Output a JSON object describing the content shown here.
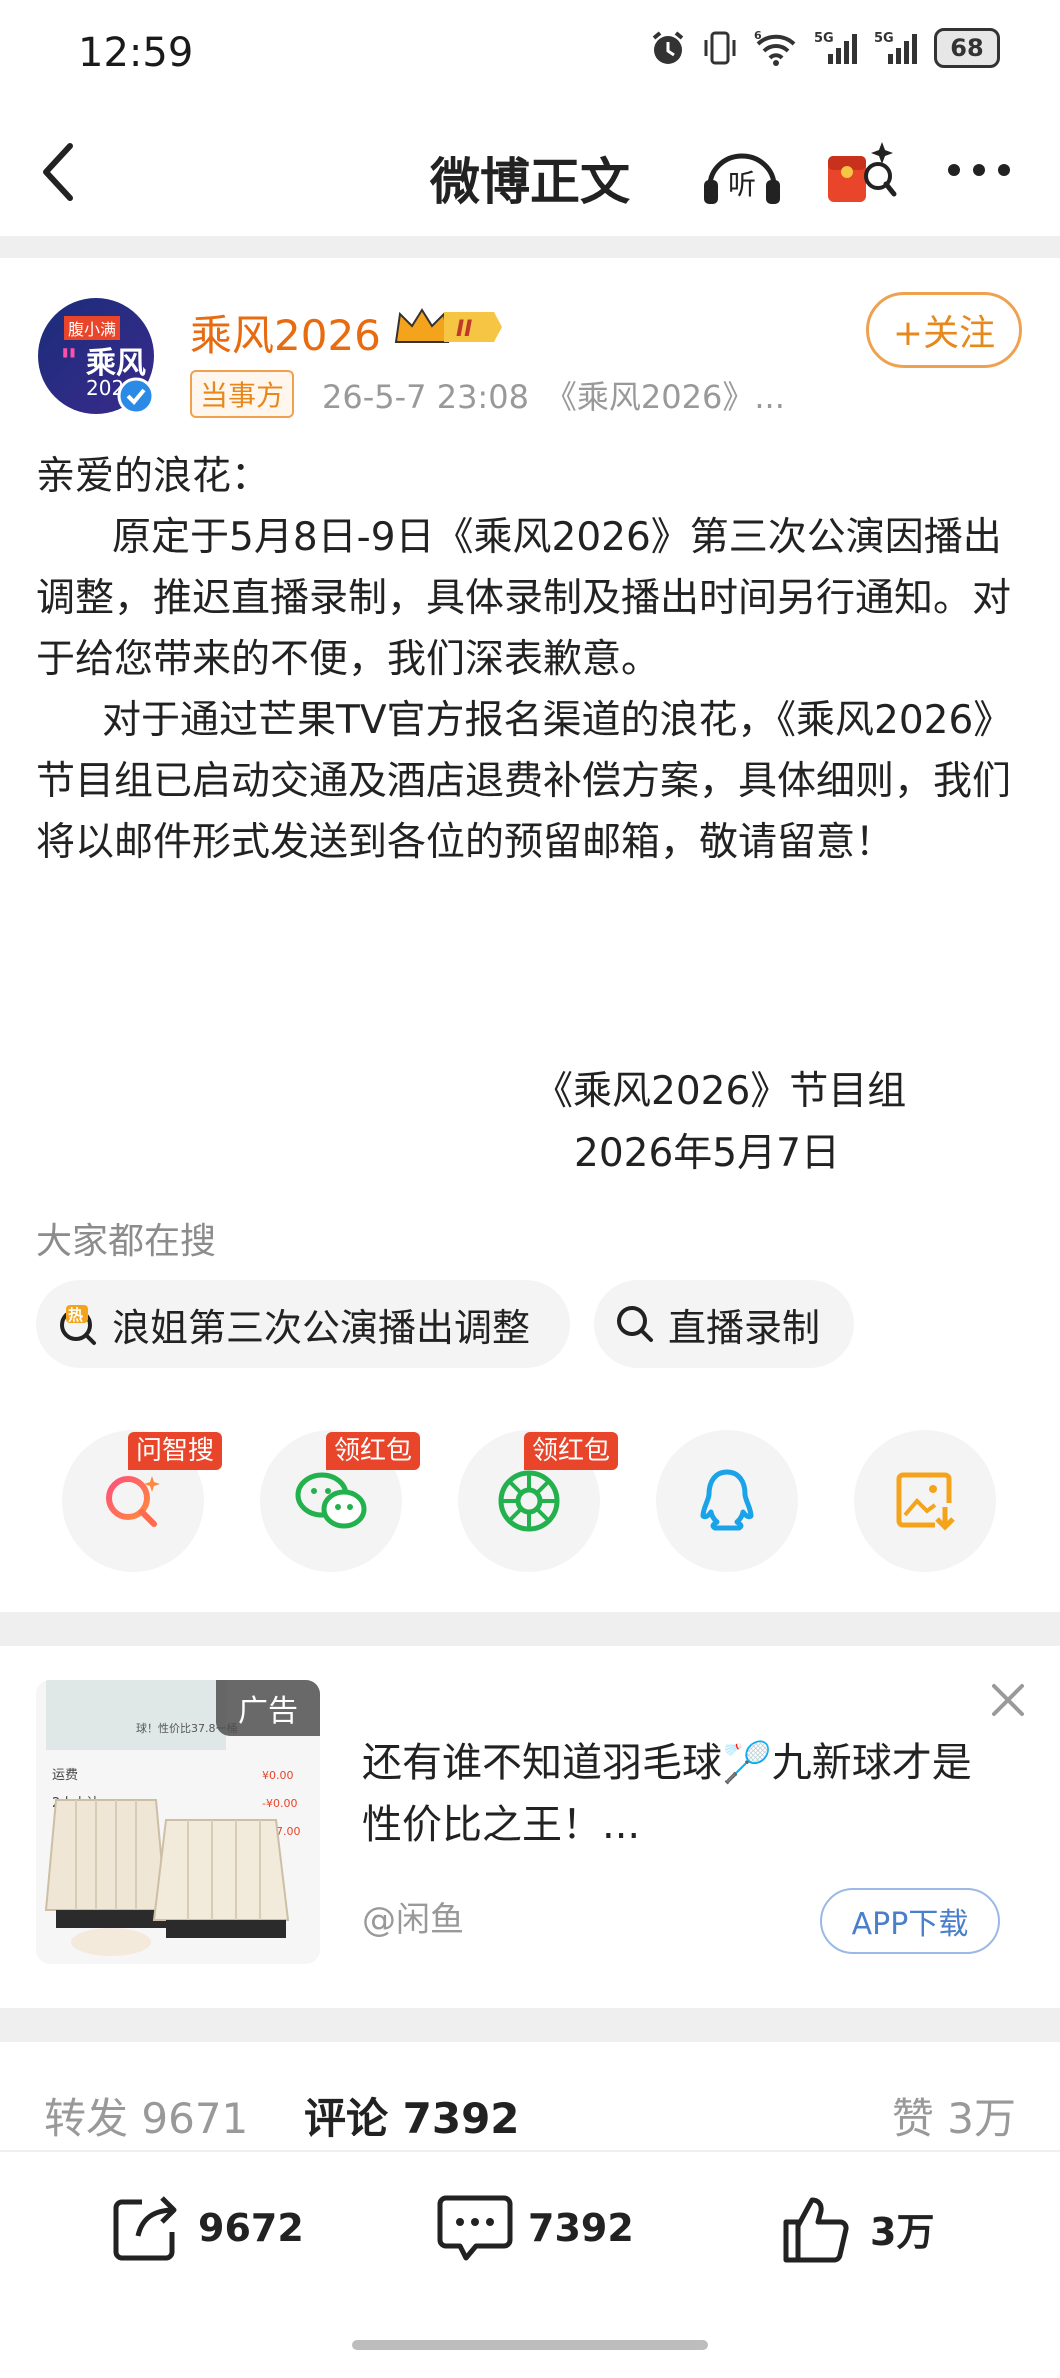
{
  "status_bar": {
    "time": "12:59",
    "battery": "68",
    "net1": "5G",
    "net2": "5G",
    "wifi_tag": "6"
  },
  "nav": {
    "title": "微博正文",
    "listen": "听"
  },
  "author": {
    "avatar_brand": "腹小满",
    "avatar_text": "乘风",
    "avatar_year": "2026",
    "name": "乘风2026",
    "level": "II",
    "role_tag": "当事方",
    "meta": "26-5-7 23:08　《乘风2026》...",
    "follow": "+关注"
  },
  "post": {
    "paragraphs": [
      "亲爱的浪花：",
      "原定于5月8日-9日《乘风2026》第三次公演因播出调整，推迟直播录制，具体录制及播出时间另行通知。对于给您带来的不便，我们深表歉意。",
      "对于通过芒果TV官方报名渠道的浪花，《乘风2026》节目组已启动交通及酒店退费补偿方案，具体细则，我们将以邮件形式发送到各位的预留邮箱，敬请留意！"
    ],
    "signature": "《乘风2026》节目组",
    "date": "2026年5月7日"
  },
  "search": {
    "label": "大家都在搜",
    "chips": [
      "浪姐第三次公演播出调整",
      "直播录制"
    ],
    "hot_tag": "热"
  },
  "share": {
    "items": [
      {
        "icon": "ai-search-icon",
        "tag": "问智搜"
      },
      {
        "icon": "wechat-icon",
        "tag": "领红包"
      },
      {
        "icon": "moments-icon",
        "tag": "领红包"
      },
      {
        "icon": "qq-icon",
        "tag": ""
      },
      {
        "icon": "save-image-icon",
        "tag": ""
      }
    ]
  },
  "ad": {
    "label": "广告",
    "text": "还有谁不知道羽毛球🏸九新球才是性价比之王！...",
    "source": "@闲鱼",
    "button": "APP下载",
    "img_rows": [
      "运费",
      "2人小计",
      "小计"
    ],
    "img_vals": [
      "¥0.00",
      "-¥0.00",
      "¥37.00"
    ],
    "img_top": "球！性价比37.8一桶"
  },
  "stats": {
    "repost_label": "转发",
    "repost_count": "9671",
    "comment_label": "评论",
    "comment_count": "7392",
    "like_label": "赞",
    "like_count": "3万"
  },
  "actions": {
    "repost": "9672",
    "comment": "7392",
    "like": "3万"
  },
  "colors": {
    "accent_orange": "#e86b0f",
    "hot_red": "#e8452a",
    "link_blue": "#4a7fcb"
  }
}
